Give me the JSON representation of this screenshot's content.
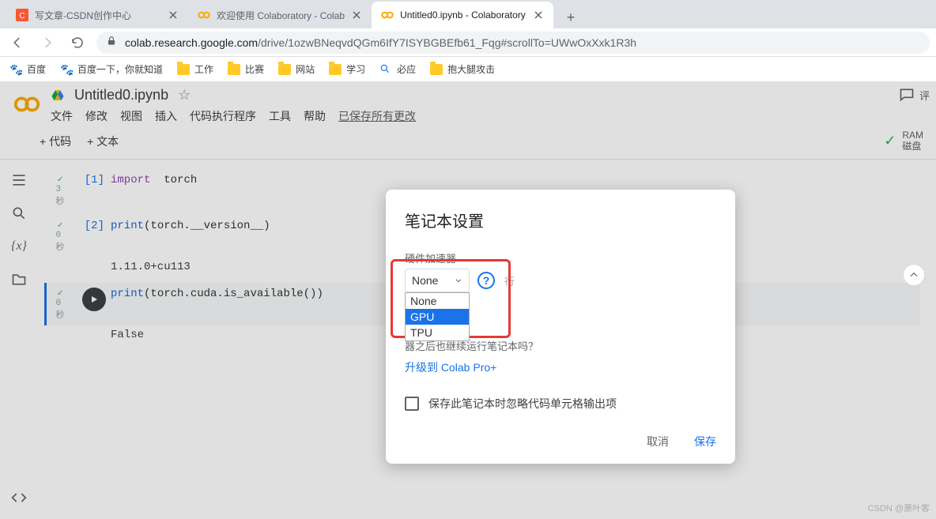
{
  "browser": {
    "tabs": [
      {
        "title": "写文章-CSDN创作中心",
        "favicon": "csdn"
      },
      {
        "title": "欢迎使用 Colaboratory - Colab",
        "favicon": "colab"
      },
      {
        "title": "Untitled0.ipynb - Colaboratory",
        "favicon": "colab",
        "active": true
      }
    ],
    "newtab": "+",
    "url_host": "colab.research.google.com",
    "url_path": "/drive/1ozwBNeqvdQGm6IfY7ISYBGBEfb61_Fqg#scrollTo=UWwOxXxk1R3h"
  },
  "bookmarks": [
    {
      "label": "百度",
      "icon": "baidu"
    },
    {
      "label": "百度一下，你就知道",
      "icon": "baidu"
    },
    {
      "label": "工作",
      "icon": "folder"
    },
    {
      "label": "比赛",
      "icon": "folder"
    },
    {
      "label": "网站",
      "icon": "folder"
    },
    {
      "label": "学习",
      "icon": "folder"
    },
    {
      "label": "必应",
      "icon": "search"
    },
    {
      "label": "抱大腿攻击",
      "icon": "folder"
    }
  ],
  "colab": {
    "title": "Untitled0.ipynb",
    "menus": [
      "文件",
      "修改",
      "视图",
      "插入",
      "代码执行程序",
      "工具",
      "帮助"
    ],
    "saved": "已保存所有更改",
    "comment": "评",
    "add_code": "+ 代码",
    "add_text": "+ 文本",
    "ram": "RAM",
    "disk": "磁盘"
  },
  "cells": [
    {
      "n": "[1]",
      "sec": "3\n秒",
      "code_html": "<span class='kw-import'>import</span>  <span class='kw-mod'>torch</span>",
      "output": ""
    },
    {
      "n": "[2]",
      "sec": "0\n秒",
      "code_html": "<span class='fn'>print</span>(torch.__version__)",
      "output": "1.11.0+cu113"
    },
    {
      "n": "",
      "sec": "0\n秒",
      "active": true,
      "code_html": "<span class='fn'>print</span>(torch.cuda.is_available())",
      "output": "False"
    }
  ],
  "dialog": {
    "title": "笔记本设置",
    "hw_label": "硬件加速器",
    "selected": "None",
    "options": [
      "None",
      "GPU",
      "TPU"
    ],
    "highlighted": "GPU",
    "hint_trail": "器之后也继续运行笔记本吗？",
    "trail_prefix": "行",
    "upgrade": "升级到 Colab Pro+",
    "checkbox_label": "保存此笔记本时忽略代码单元格输出项",
    "cancel": "取消",
    "save": "保存"
  },
  "watermark": "CSDN @萧叶客"
}
